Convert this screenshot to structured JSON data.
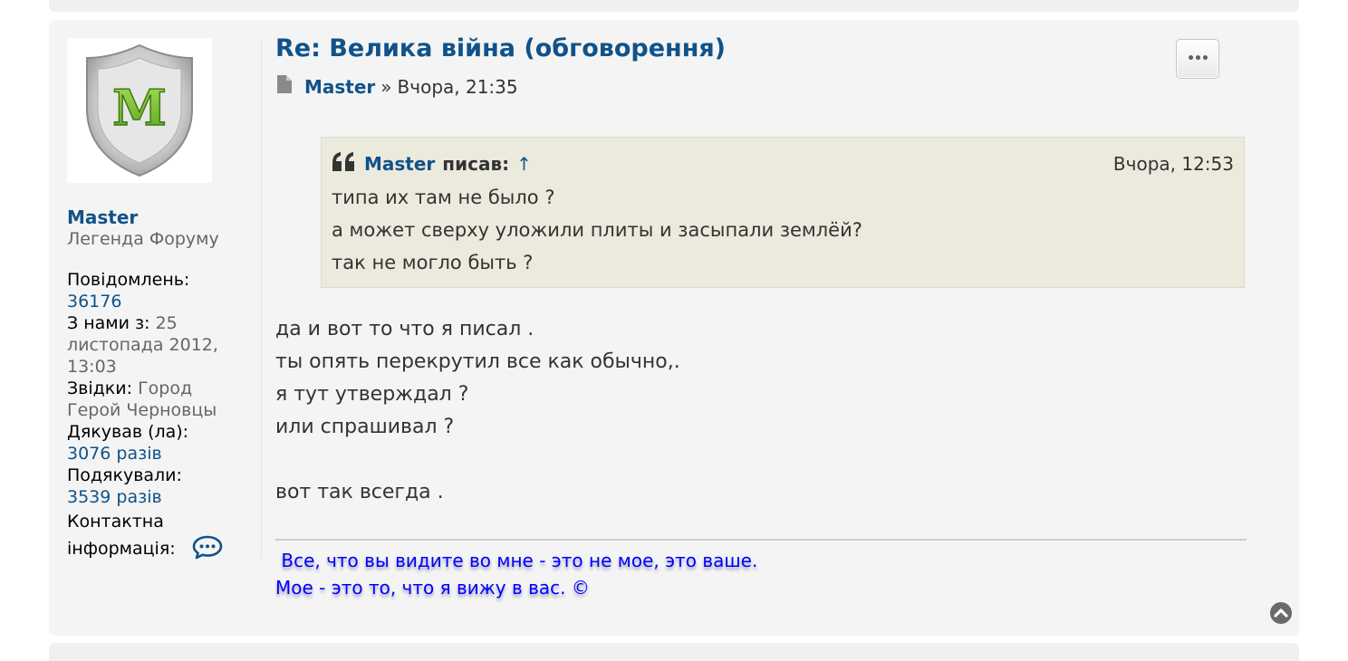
{
  "post": {
    "title": "Re: Велика війна (обговорення)",
    "author": "Master",
    "separator": "»",
    "time": "Вчора, 21:35",
    "menu_label": "•••"
  },
  "profile": {
    "avatar_letter": "M",
    "username": "Master",
    "rank": "Легенда Форуму",
    "posts_label": "Повідомлень:",
    "posts_value": "36176",
    "joined_label": "З нами з:",
    "joined_value": "25 листопада 2012, 13:03",
    "location_label": "Звідки:",
    "location_value": "Город Герой Черновцы",
    "thanked_label": "Дякував (ла):",
    "thanked_value": "3076 разів",
    "been_thanked_label": "Подякували:",
    "been_thanked_value": "3539 разів",
    "contact_label": "Контактна інформація:"
  },
  "quote": {
    "author": "Master",
    "wrote": "писав:",
    "up_arrow": "↑",
    "time": "Вчора, 12:53",
    "lines": [
      "типа их там не было ?",
      "а может сверху уложили плиты и засыпали землёй?",
      "так не могло быть ?"
    ]
  },
  "message": {
    "lines": [
      "да и вот то что я писал .",
      "ты опять перекрутил все как обычно,.",
      "я тут утверждал ?",
      "или спрашивал ?"
    ],
    "last_line": "вот так всегда ."
  },
  "signature": {
    "line1": " Все, что вы видите во мне - это не мое, это ваше.",
    "line2": "Мое - это то, что я вижу в вас. ©"
  },
  "colors": {
    "link": "#105289",
    "post_bg": "#f4f4f4",
    "quote_bg": "#ebeadd",
    "signature": "#0000ff"
  }
}
